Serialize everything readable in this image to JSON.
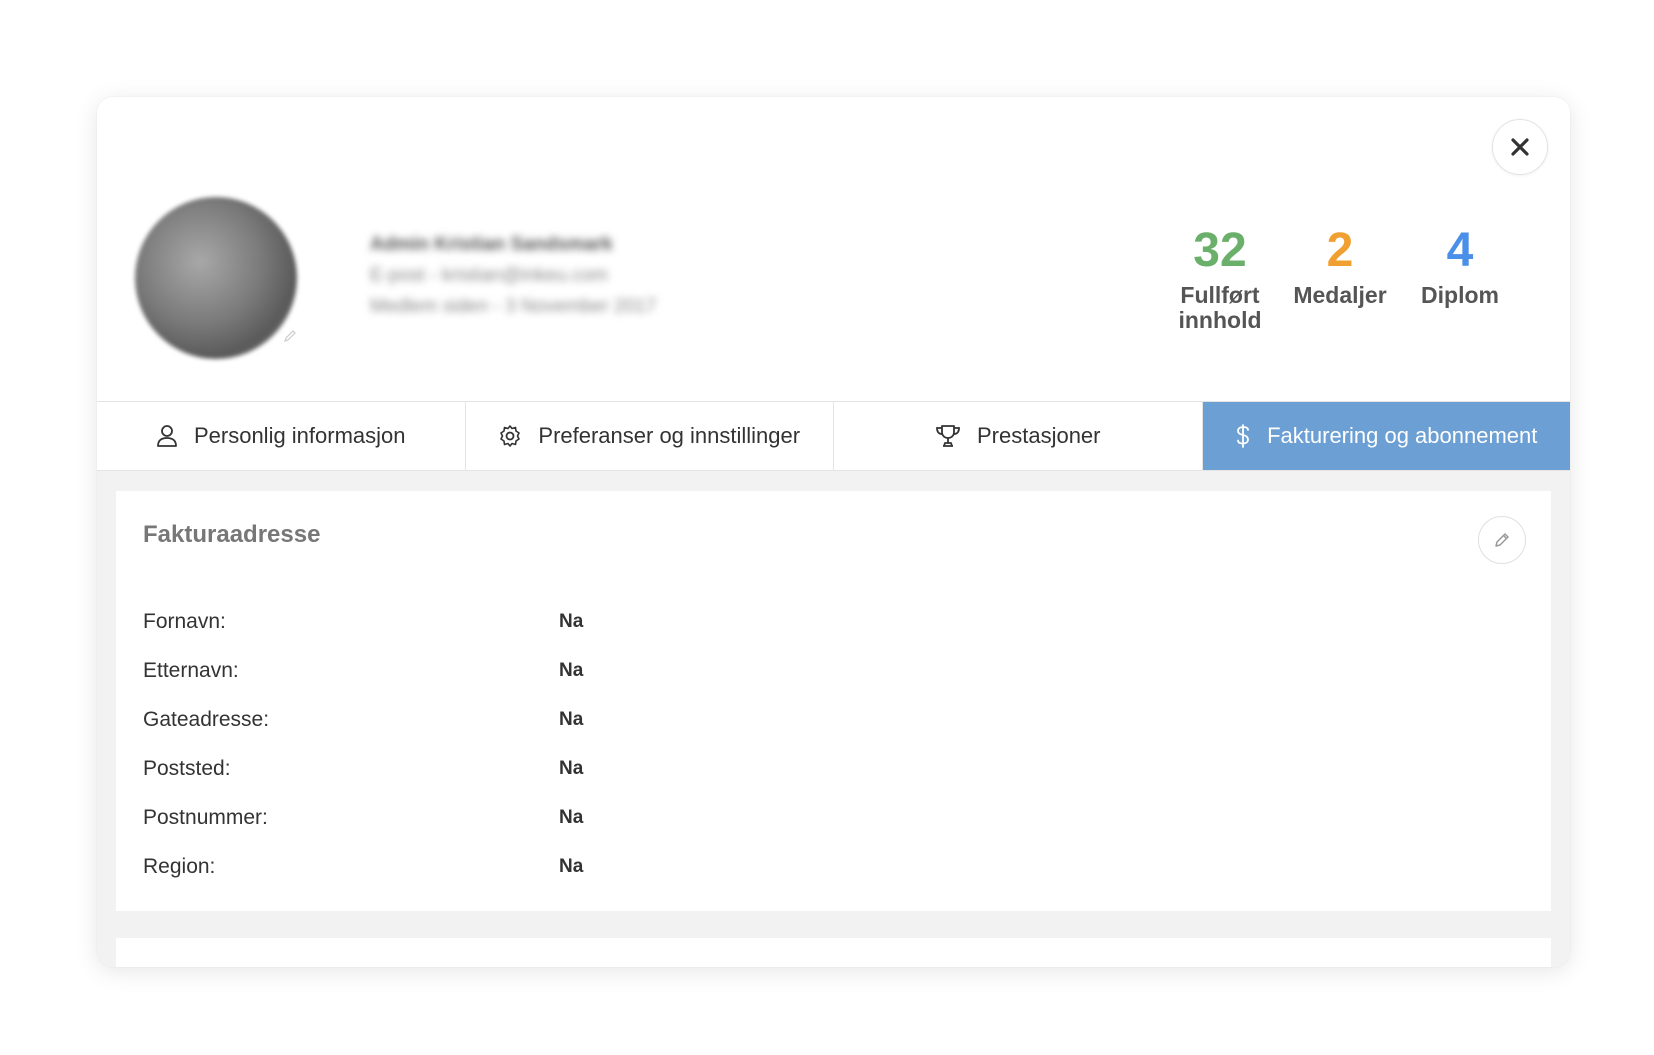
{
  "profile": {
    "name": "Admin Kristian Sandsmark",
    "email": "E-post - kristian@inkeu.com",
    "member_since": "Medlem siden - 3 November 2017"
  },
  "stats": [
    {
      "value": "32",
      "label": "Fullført innhold",
      "color": "#6aaf6a"
    },
    {
      "value": "2",
      "label": "Medaljer",
      "color": "#f0a030"
    },
    {
      "value": "4",
      "label": "Diplom",
      "color": "#4a8fe8"
    }
  ],
  "tabs": [
    {
      "label": "Personlig informasjon",
      "icon": "user-icon"
    },
    {
      "label": "Preferanser og innstillinger",
      "icon": "gear-icon"
    },
    {
      "label": "Prestasjoner",
      "icon": "trophy-icon"
    },
    {
      "label": "Fakturering og abonnement",
      "icon": "dollar-icon",
      "active": true
    }
  ],
  "billing": {
    "title": "Fakturaadresse",
    "fields": [
      {
        "label": "Fornavn:",
        "value": "Na"
      },
      {
        "label": "Etternavn:",
        "value": "Na"
      },
      {
        "label": "Gateadresse:",
        "value": "Na"
      },
      {
        "label": "Poststed:",
        "value": "Na"
      },
      {
        "label": "Postnummer:",
        "value": "Na"
      },
      {
        "label": "Region:",
        "value": "Na"
      }
    ]
  },
  "colors": {
    "accent": "#6c9fd4",
    "content_bg": "#f2f2f2"
  }
}
